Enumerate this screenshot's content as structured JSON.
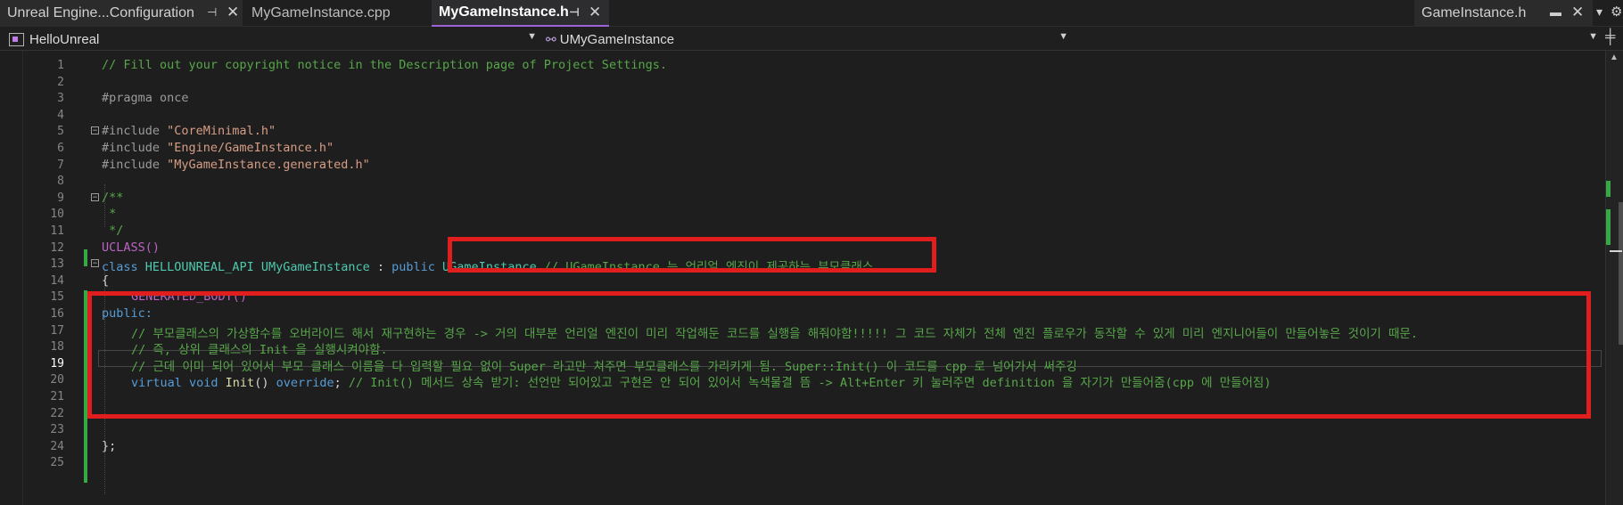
{
  "tabs": [
    {
      "label": "Unreal Engine...Configuration"
    },
    {
      "label": "MyGameInstance.cpp"
    },
    {
      "label": "MyGameInstance.h"
    }
  ],
  "right_tab": {
    "label": "GameInstance.h"
  },
  "navbar": {
    "project": "HelloUnreal",
    "scope": "UMyGameInstance",
    "member": ""
  },
  "icons": {
    "pin": "pin-icon",
    "close": "close-icon",
    "dropdown": "chevron-down-icon",
    "gear": "gear-icon",
    "split": "split-editor-icon",
    "fold": "collapse-icon"
  },
  "colors": {
    "comment": "#57a64a",
    "keyword": "#569cd6",
    "string": "#d69d85",
    "class": "#4ec9b0",
    "macro": "#bd63c5",
    "annotation_box": "#e01e1e"
  },
  "editor": {
    "current_line": 19,
    "lines": [
      {
        "n": "1",
        "text": "// Fill out your copyright notice in the Description page of Project Settings."
      },
      {
        "n": "2",
        "text": ""
      },
      {
        "n": "3",
        "text": "#pragma once"
      },
      {
        "n": "4",
        "text": ""
      },
      {
        "n": "5",
        "pp": "#include ",
        "str": "\"CoreMinimal.h\""
      },
      {
        "n": "6",
        "pp": "#include ",
        "str": "\"Engine/GameInstance.h\""
      },
      {
        "n": "7",
        "pp": "#include ",
        "str": "\"MyGameInstance.generated.h\""
      },
      {
        "n": "8",
        "text": ""
      },
      {
        "n": "9",
        "text": "/**"
      },
      {
        "n": "10",
        "text": " *"
      },
      {
        "n": "11",
        "text": " */"
      },
      {
        "n": "12",
        "text": "UCLASS()"
      },
      {
        "n": "13",
        "kw": "class ",
        "api": "HELLOUNREAL_API ",
        "cls": "UMyGameInstance",
        "mid": " : ",
        "kw2": "public ",
        "cls2": "UGameInstance",
        "com": " // UGameInstance 는 언리얼 엔진이 제공하는 부모클래스"
      },
      {
        "n": "14",
        "text": "{"
      },
      {
        "n": "15",
        "text": "GENERATED_BODY()"
      },
      {
        "n": "16",
        "text": "public:"
      },
      {
        "n": "17",
        "text": "// 부모클래스의 가상함수를 오버라이드 해서 재구현하는 경우 -> 거의 대부분 언리얼 엔진이 미리 작업해둔 코드를 실행을 해줘야함!!!!! 그 코드 자체가 전체 엔진 플로우가 동작할 수 있게 미리 엔지니어들이 만들어놓은 것이기 때문."
      },
      {
        "n": "18",
        "text": "// 즉, 상위 클래스의 Init 을 실행시켜야함."
      },
      {
        "n": "19",
        "text": "// 근데 이미 되어 있어서 부모 클래스 이름을 다 입력할 필요 없이 Super 라고만 쳐주면 부모클래스를 가리키게 됨. Super::Init() 이 코드를 cpp 로 넘어가서 써주깅"
      },
      {
        "n": "20",
        "kw": "virtual ",
        "kw2": "void ",
        "fn": "Init",
        "mid": "() ",
        "kw3": "override",
        "end": "; ",
        "com": "// Init() 메서드 상속 받기: 선언만 되어있고 구현은 안 되어 있어서 녹색물결 뜸 -> Alt+Enter 키 눌러주면 definition 을 자기가 만들어줌(cpp 에 만들어짐)"
      },
      {
        "n": "21",
        "text": ""
      },
      {
        "n": "22",
        "text": ""
      },
      {
        "n": "23",
        "text": ""
      },
      {
        "n": "24",
        "text": "};"
      },
      {
        "n": "25",
        "text": ""
      }
    ]
  }
}
